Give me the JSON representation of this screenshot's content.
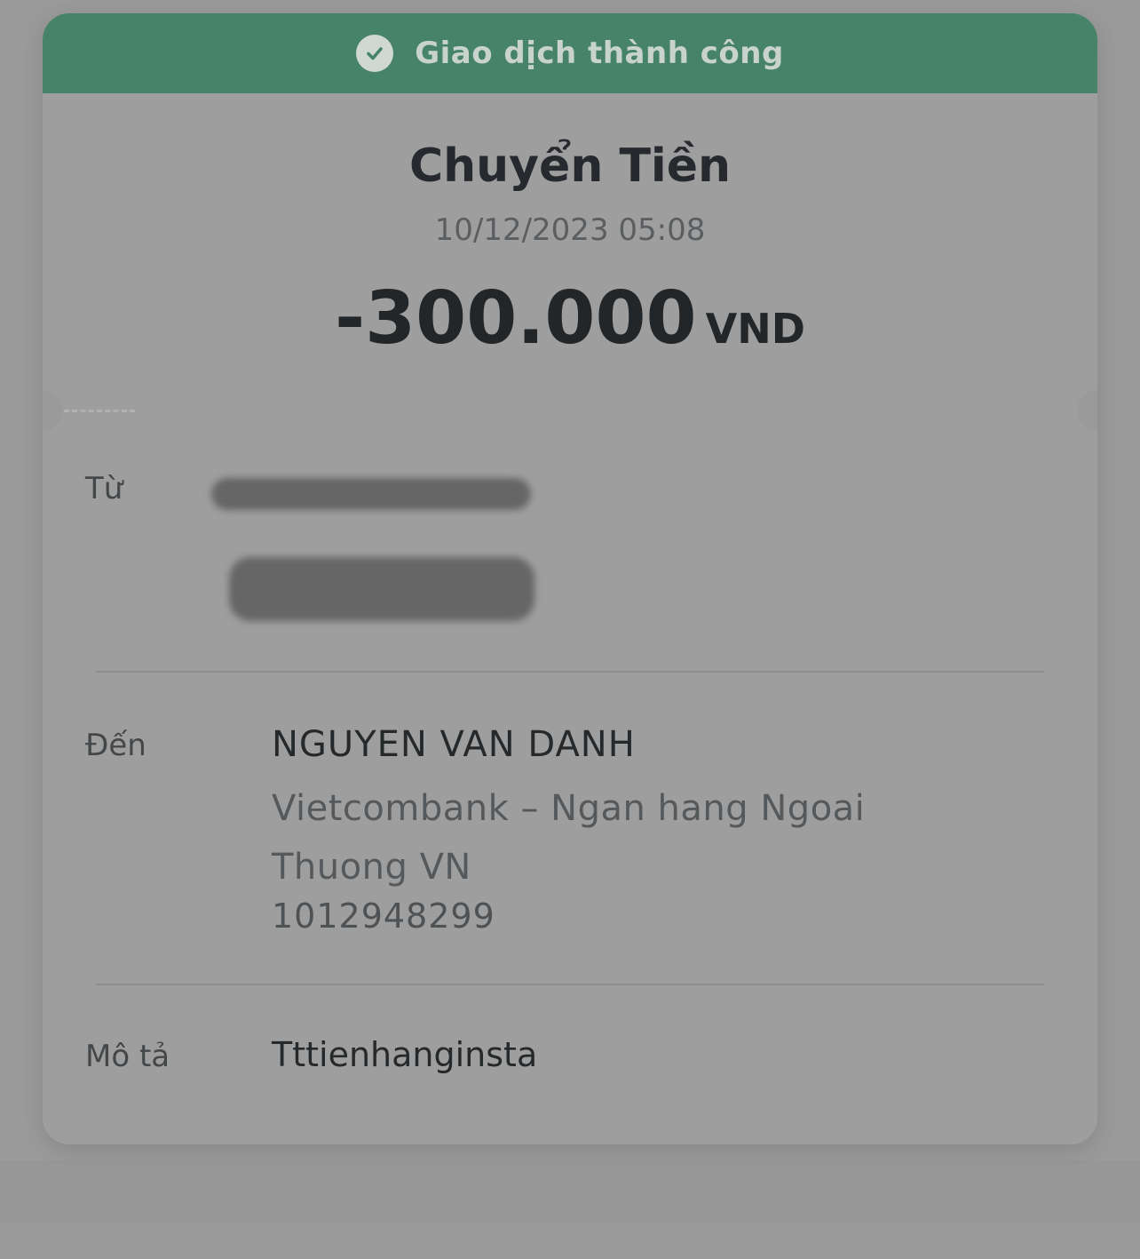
{
  "status": {
    "icon": "check-circle-icon",
    "text": "Giao dịch thành công",
    "color": "#478368"
  },
  "transaction": {
    "title": "Chuyển Tiền",
    "datetime": "10/12/2023 05:08",
    "amount": "-300.000",
    "currency": "VND"
  },
  "from": {
    "label": "Từ"
  },
  "to": {
    "label": "Đến",
    "name": "NGUYEN VAN DANH",
    "bank_line1": "Vietcombank – Ngan hang Ngoai",
    "bank_line2": "Thuong VN",
    "account_number": "1012948299"
  },
  "description": {
    "label": "Mô tả",
    "value": "Tttienhanginsta"
  }
}
